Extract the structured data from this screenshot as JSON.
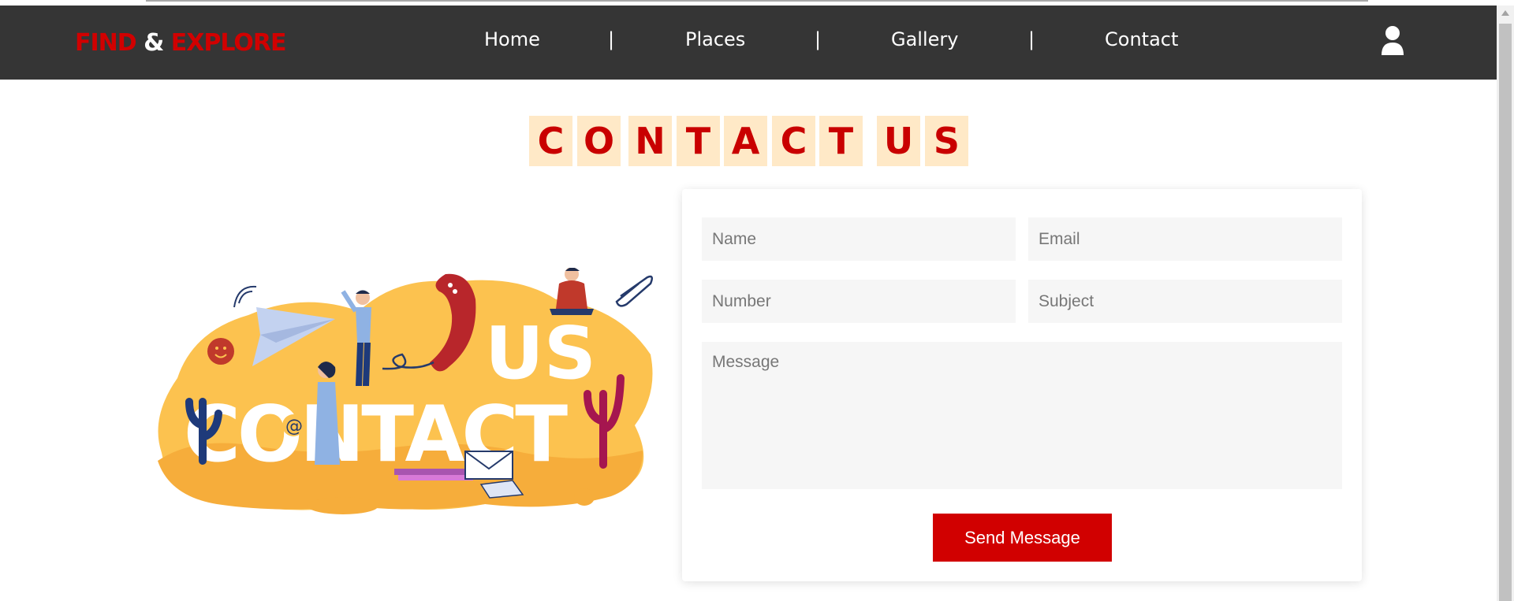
{
  "brand": {
    "part1": "FIND",
    "amp": "&",
    "part2": "EXPLORE"
  },
  "nav": {
    "items": [
      "Home",
      "Places",
      "Gallery",
      "Contact"
    ],
    "separator": "|"
  },
  "heading": {
    "letters": [
      "C",
      "O",
      "N",
      "T",
      "A",
      "C",
      "T",
      "U",
      "S"
    ]
  },
  "illustration": {
    "big_word_1": "US",
    "big_word_2": "CONTACT",
    "at_symbol": "@"
  },
  "form": {
    "name_placeholder": "Name",
    "email_placeholder": "Email",
    "number_placeholder": "Number",
    "subject_placeholder": "Subject",
    "message_placeholder": "Message",
    "submit_label": "Send Message"
  },
  "colors": {
    "accent": "#d10000",
    "navbar": "#353535",
    "letter_bg": "#ffe9c7",
    "blob": "#fcc24f"
  },
  "icons": {
    "user": "user-icon"
  }
}
